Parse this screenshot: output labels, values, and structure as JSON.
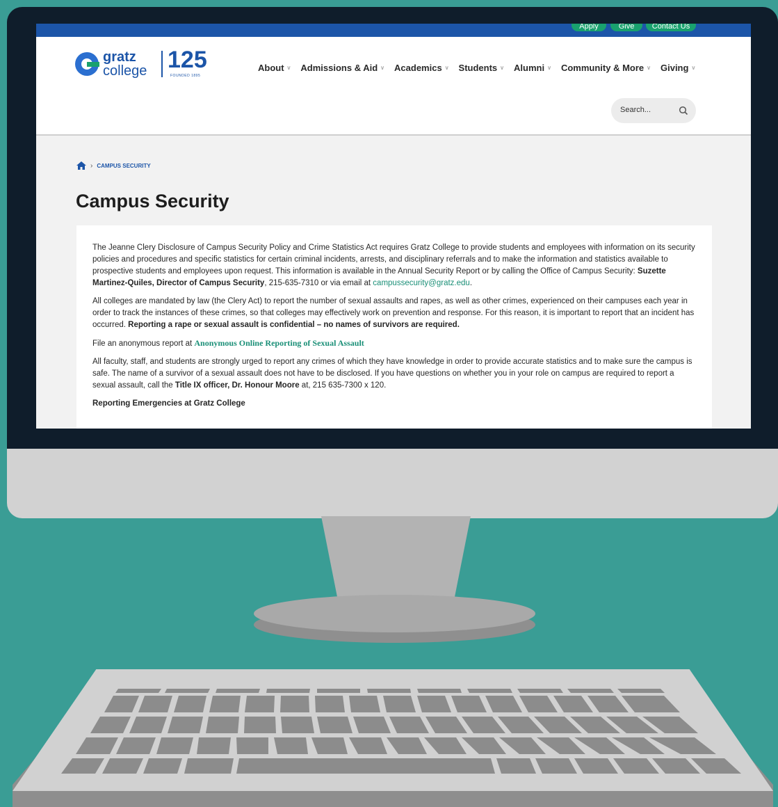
{
  "topbar": {
    "buttons": [
      "Apply",
      "Give",
      "Contact Us"
    ]
  },
  "logo": {
    "word1": "gratz",
    "word2": "college",
    "number": "125",
    "founded": "FOUNDED 1895"
  },
  "nav": {
    "items": [
      "About",
      "Admissions & Aid",
      "Academics",
      "Students",
      "Alumni",
      "Community & More",
      "Giving"
    ]
  },
  "search": {
    "placeholder": "Search..."
  },
  "breadcrumb": {
    "current": "CAMPUS SECURITY"
  },
  "page": {
    "title": "Campus Security",
    "p1_a": "The Jeanne Clery Disclosure of Campus Security Policy and Crime Statistics Act requires Gratz College to provide students and employees with information on its security policies and procedures and specific statistics for certain criminal incidents, arrests, and disciplinary referrals and to make the information and statistics available to prospective students and employees upon request. This information is available in the Annual Security Report or by calling the Office of Campus Security: ",
    "p1_name": "Suzette Martinez-Quiles, Director of Campus Security",
    "p1_b": ", 215-635-7310 or via email at ",
    "p1_email": "campussecurity@gratz.edu",
    "p1_c": ".",
    "p2_a": "All colleges are mandated by law (the Clery Act) to report the number of sexual assaults and rapes, as well as other crimes, experienced on their campuses each year in order to track the instances of these crimes, so that colleges may effectively work on prevention and response. For this reason, it is important to report that an incident has occurred. ",
    "p2_bold": "Reporting a rape or sexual assault is confidential – no names of survivors are required.",
    "p3_a": "File an anonymous report at ",
    "p3_link": "Anonymous Online Reporting of Sexual Assault",
    "p4_a": "All faculty, staff, and students are strongly urged to report any crimes of which they have knowledge in order to provide accurate statistics and to make sure the campus is safe. The name of a survivor of a sexual assault does not have to be disclosed.  If you have questions on whether you in your role on campus are required to report a sexual assault, call the ",
    "p4_bold": "Title IX officer, Dr. Honour Moore",
    "p4_b": " at, 215 635-7300 x 120.",
    "p5_heading": "Reporting Emergencies at Gratz College"
  },
  "colors": {
    "background": "#3a9d95",
    "brand_blue": "#1c55a8",
    "brand_green": "#19a16e",
    "link": "#1a8f77"
  }
}
